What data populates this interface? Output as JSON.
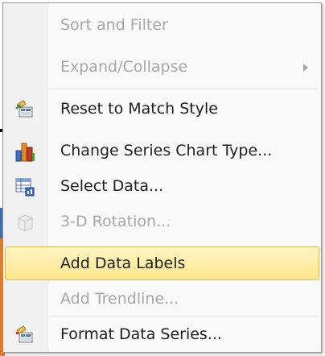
{
  "menu": {
    "items": [
      {
        "label": "Sort and Filter",
        "enabled": false,
        "icon": null
      },
      {
        "label": "Expand/Collapse",
        "enabled": false,
        "icon": null,
        "submenu": true
      },
      {
        "label": "Reset to Match Style",
        "enabled": true,
        "icon": "reset-style-icon"
      },
      {
        "label": "Change Series Chart Type...",
        "enabled": true,
        "icon": "chart-type-icon"
      },
      {
        "label": "Select Data...",
        "enabled": true,
        "icon": "select-data-icon"
      },
      {
        "label": "3-D Rotation...",
        "enabled": false,
        "icon": "3d-rotation-icon"
      },
      {
        "label": "Add Data Labels",
        "enabled": true,
        "icon": null,
        "highlighted": true
      },
      {
        "label": "Add Trendline...",
        "enabled": false,
        "icon": null
      },
      {
        "label": "Format Data Series...",
        "enabled": true,
        "icon": "format-series-icon"
      }
    ]
  },
  "colors": {
    "highlight_top": "#fff5c7",
    "highlight_bottom": "#fde68a",
    "highlight_border": "#e2b84d",
    "disabled_text": "#a6a6a6",
    "enabled_text": "#1e1e1e"
  }
}
